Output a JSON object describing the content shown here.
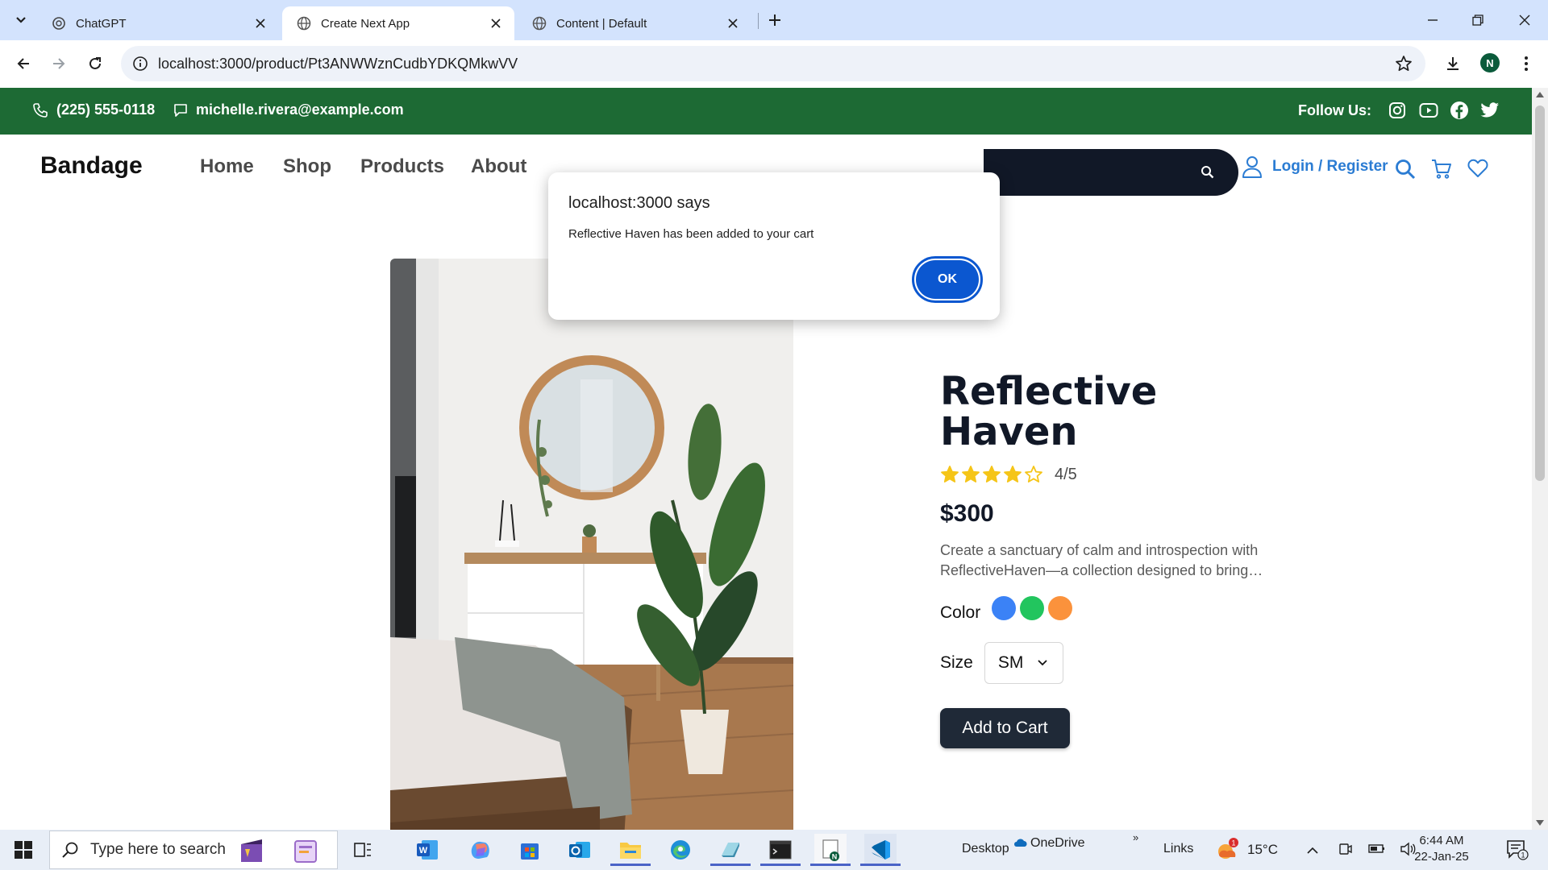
{
  "browser": {
    "tabs": [
      {
        "title": "ChatGPT",
        "active": false
      },
      {
        "title": "Create Next App",
        "active": true
      },
      {
        "title": "Content | Default",
        "active": false
      }
    ],
    "url": "localhost:3000/product/Pt3ANWWznCudbYDKQMkwVV",
    "profile_initial": "N"
  },
  "topbar": {
    "phone": "(225) 555-0118",
    "email": "michelle.rivera@example.com",
    "follow_label": "Follow Us:",
    "social_icons": [
      "instagram-icon",
      "youtube-icon",
      "facebook-icon",
      "twitter-icon"
    ]
  },
  "navbar": {
    "brand": "Bandage",
    "links": [
      "Home",
      "Shop",
      "Products",
      "About"
    ],
    "login_label": "Login / Register"
  },
  "product": {
    "title": "Reflective Haven",
    "rating_value": 4,
    "rating_max": 5,
    "rating_text": "4/5",
    "price": "$300",
    "description": "Create a sanctuary of calm and introspection with ReflectiveHaven—a collection designed to bring…",
    "color_label": "Color",
    "colors": [
      "#3b82f6",
      "#22c55e",
      "#fb923c"
    ],
    "size_label": "Size",
    "size_selected": "SM",
    "add_to_cart_label": "Add to Cart"
  },
  "alert": {
    "title": "localhost:3000 says",
    "message": "Reflective Haven has been added to your cart",
    "ok_label": "OK"
  },
  "taskbar": {
    "search_placeholder": "Type here to search",
    "desktop_label": "Desktop",
    "onedrive_label": "OneDrive",
    "links_label": "Links",
    "weather_temp": "15°C",
    "weather_badge": "1",
    "time": "6:44 AM",
    "date": "22-Jan-25",
    "notification_count": "1"
  },
  "colors": {
    "tabbar_bg": "#d3e3fd",
    "topbar_green": "#1d6a34",
    "brand_blue": "#2b7cd3",
    "dark_navy": "#111827",
    "alert_ok_blue": "#0b57d0",
    "star_yellow": "#f5c518"
  }
}
